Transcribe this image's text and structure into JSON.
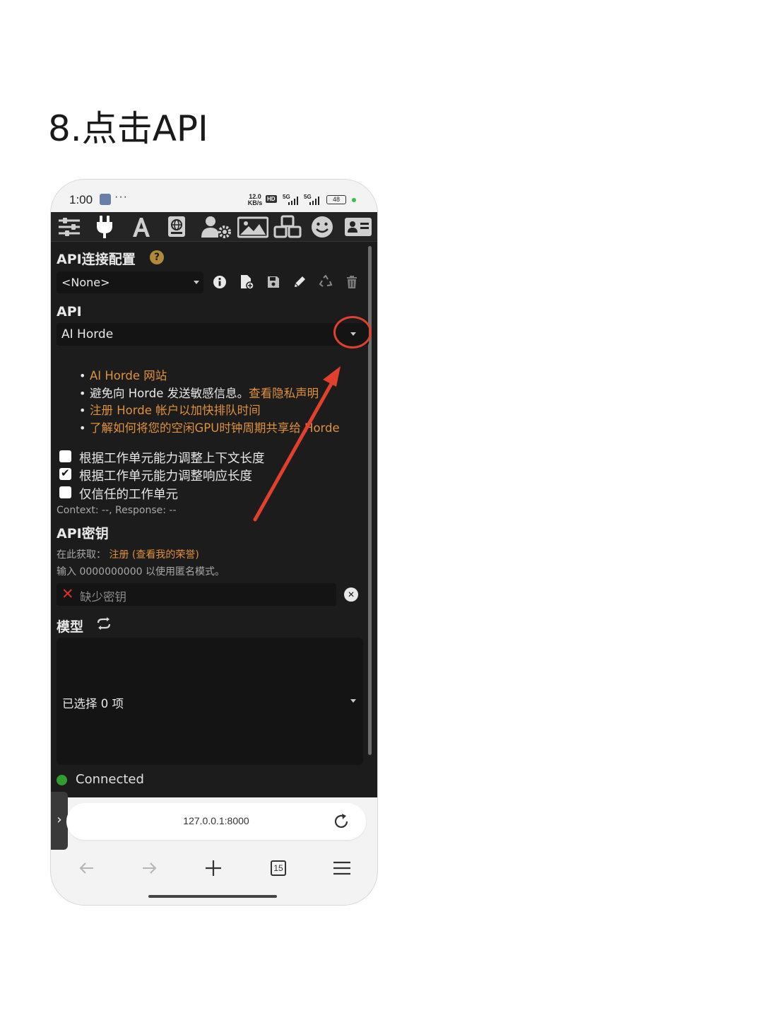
{
  "heading": "8.点击API",
  "status_bar": {
    "time": "1:00",
    "dots": "···",
    "speed_value": "12.0",
    "speed_unit": "KB/s",
    "hd_label": "HD",
    "network_1": "5G",
    "network_2": "5G",
    "battery": "48"
  },
  "toolbar": {
    "icons": [
      "sliders-icon",
      "plug-icon",
      "font-icon",
      "book-globe-icon",
      "user-gear-icon",
      "image-icon",
      "cubes-icon",
      "smiley-icon",
      "id-card-icon"
    ]
  },
  "api_profile": {
    "title": "API连接配置",
    "help": "?",
    "selected": "<None>"
  },
  "api": {
    "title": "API",
    "selected": "AI Horde"
  },
  "links": [
    {
      "text": "AI Horde 网站",
      "accent": true
    },
    {
      "prefix": "避免向 Horde 发送敏感信息。",
      "accent_text": "查看隐私声明"
    },
    {
      "text": "注册 Horde 帐户以加快排队时间",
      "accent": true
    },
    {
      "text": "了解如何将您的空闲GPU时钟周期共享给 Horde",
      "accent": true
    }
  ],
  "checkboxes": [
    {
      "label": "根据工作单元能力调整上下文长度",
      "checked": false
    },
    {
      "label": "根据工作单元能力调整响应长度",
      "checked": true
    },
    {
      "label": "仅信任的工作单元",
      "checked": false
    }
  ],
  "context_info": "Context: --, Response: --",
  "api_key": {
    "title": "API密钥",
    "obtain_prefix": "在此获取：",
    "obtain_link": "注册",
    "obtain_link2": "(查看我的荣誉)",
    "anon_hint": "输入 0000000000 以使用匿名模式。",
    "placeholder": "缺少密钥",
    "clear": "✕"
  },
  "models": {
    "title": "模型",
    "selected_text": "已选择 0 项"
  },
  "connection": {
    "status": "Connected"
  },
  "browser": {
    "url": "127.0.0.1:8000",
    "tab_count": "15",
    "side_tab": "›"
  },
  "colors": {
    "accent": "#e0903c",
    "annotation": "#e2402f",
    "connected": "#2f9e2f",
    "panel": "#1c1c1c"
  }
}
